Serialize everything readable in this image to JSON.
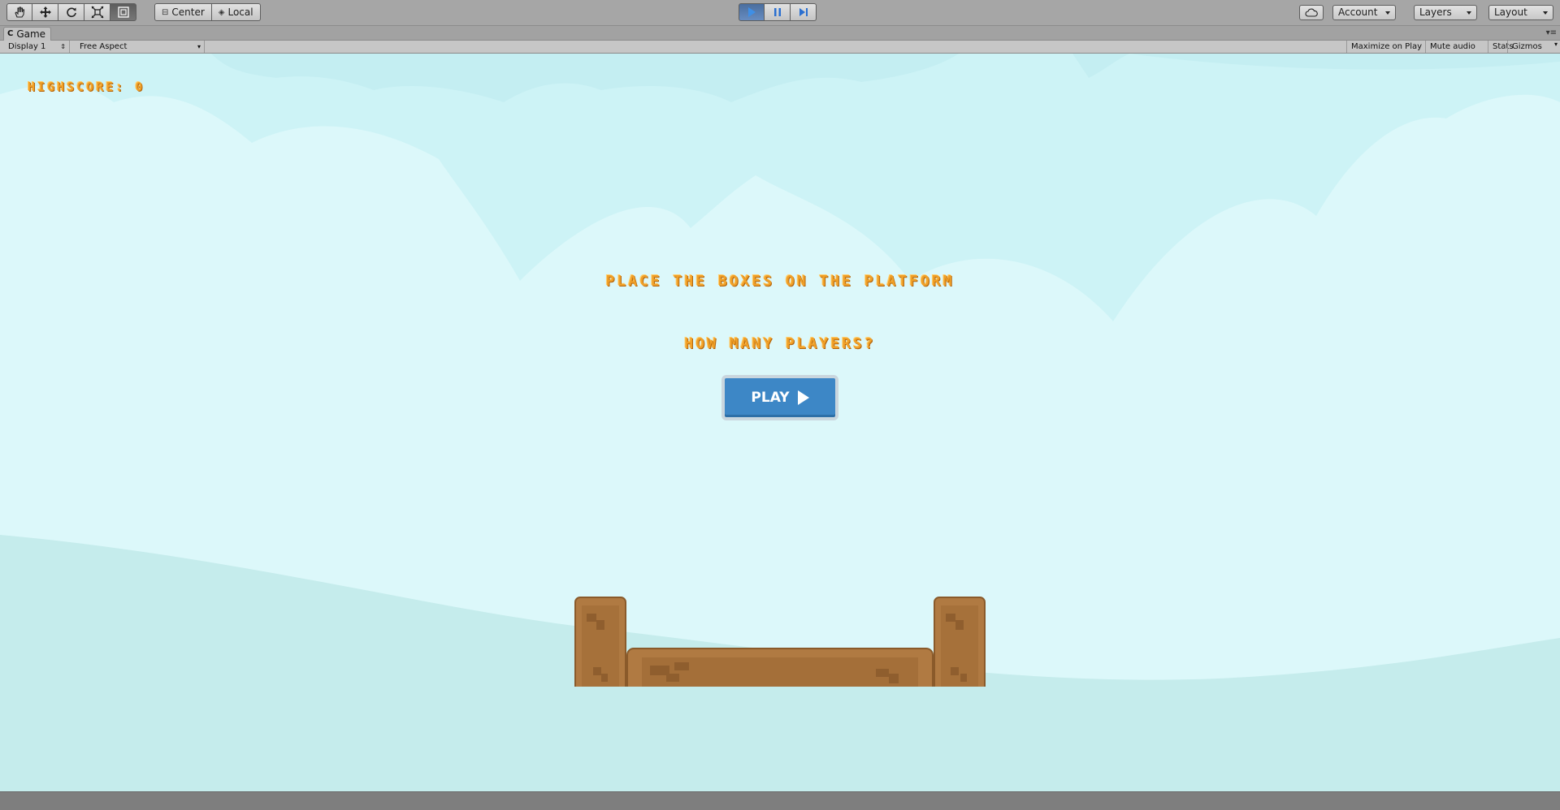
{
  "toolbar": {
    "tools": [
      "hand-tool",
      "move-tool",
      "rotate-tool",
      "scale-tool",
      "rect-tool"
    ],
    "pivot_center": "Center",
    "pivot_local": "Local",
    "account": "Account",
    "layers": "Layers",
    "layout": "Layout"
  },
  "tab": {
    "title": "Game"
  },
  "gamebar": {
    "display": "Display 1",
    "aspect": "Free Aspect",
    "maximize": "Maximize on Play",
    "mute": "Mute audio",
    "stats": "Stats",
    "gizmos": "Gizmos"
  },
  "game": {
    "highscore": "HIGHSCORE: 0",
    "title": "PLACE THE BOXES ON THE PLATFORM",
    "players_question": "HOW MANY PLAYERS?",
    "play_label": "PLAY"
  },
  "colors": {
    "sky": "#dcf8fa",
    "cloud_dark": "#c8f0f4",
    "ground": "#c5ecec",
    "text_orange": "#f0a028",
    "button_blue": "#3d87c6",
    "wood": "#b07a42"
  }
}
